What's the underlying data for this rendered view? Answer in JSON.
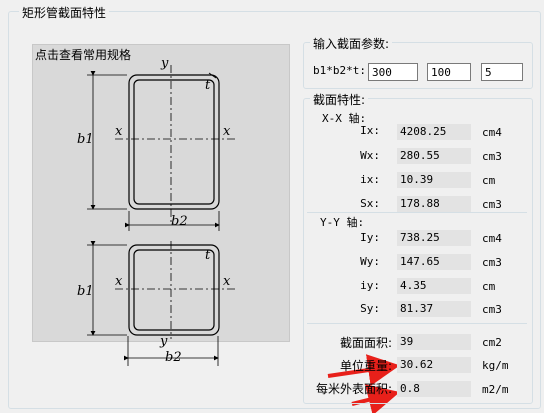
{
  "group_title": "矩形管截面特性",
  "drawing_link": "点击查看常用规格",
  "input_group": {
    "title": "输入截面参数:",
    "label": "b1*b2*t:",
    "b1": "300",
    "b2": "100",
    "t": "5"
  },
  "section_group": {
    "title": "截面特性:",
    "xx_axis": {
      "title": "X-X 轴:",
      "rows": [
        {
          "label": "Ix:",
          "value": "4208.25",
          "unit": "cm4"
        },
        {
          "label": "Wx:",
          "value": "280.55",
          "unit": "cm3"
        },
        {
          "label": "ix:",
          "value": "10.39",
          "unit": "cm"
        },
        {
          "label": "Sx:",
          "value": "178.88",
          "unit": "cm3"
        }
      ]
    },
    "yy_axis": {
      "title": "Y-Y 轴:",
      "rows": [
        {
          "label": "Iy:",
          "value": "738.25",
          "unit": "cm4"
        },
        {
          "label": "Wy:",
          "value": "147.65",
          "unit": "cm3"
        },
        {
          "label": "iy:",
          "value": "4.35",
          "unit": "cm"
        },
        {
          "label": "Sy:",
          "value": "81.37",
          "unit": "cm3"
        }
      ]
    },
    "bottom": [
      {
        "label": "截面面积:",
        "value": "39",
        "unit": "cm2"
      },
      {
        "label": "单位重量:",
        "value": "30.62",
        "unit": "kg/m"
      },
      {
        "label": "每米外表面积:",
        "value": "0.8",
        "unit": "m2/m"
      }
    ]
  },
  "diagram_labels": {
    "y": "y",
    "x": "x",
    "t": "t",
    "b1": "b1",
    "b2": "b2"
  },
  "colors": {
    "arrow": "#e8201a",
    "value_bg": "#e3e3e3"
  }
}
